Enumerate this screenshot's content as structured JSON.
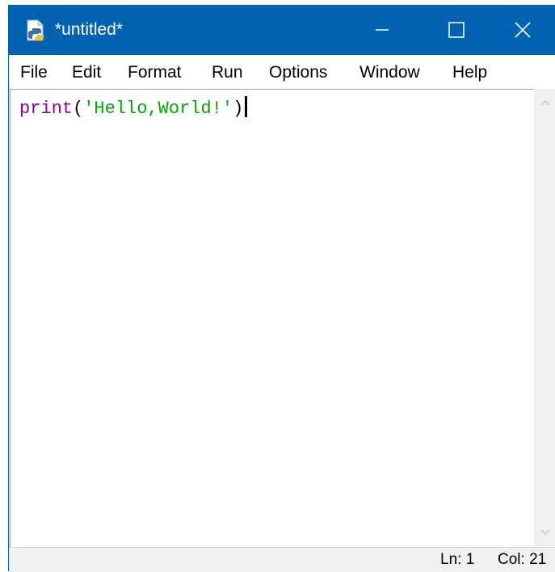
{
  "window": {
    "title": "*untitled*",
    "app_icon": "python-idle-icon",
    "controls": {
      "minimize_icon": "minimize-icon",
      "maximize_icon": "maximize-icon",
      "close_icon": "close-icon"
    },
    "titlebar_color": "#0063b1"
  },
  "menu": {
    "items": [
      {
        "label": "File"
      },
      {
        "label": "Edit"
      },
      {
        "label": "Format"
      },
      {
        "label": "Run"
      },
      {
        "label": "Options"
      },
      {
        "label": "Window"
      },
      {
        "label": "Help"
      }
    ]
  },
  "editor": {
    "tokens": {
      "builtin": "print",
      "open_paren": "(",
      "string": "'Hello,World!'",
      "close_paren": ")"
    },
    "colors": {
      "builtin": "#900090",
      "string": "#00aa00"
    }
  },
  "scrollbar": {
    "up_icon": "chevron-up-icon",
    "down_icon": "chevron-down-icon"
  },
  "status": {
    "line": "Ln: 1",
    "column": "Col: 21"
  }
}
